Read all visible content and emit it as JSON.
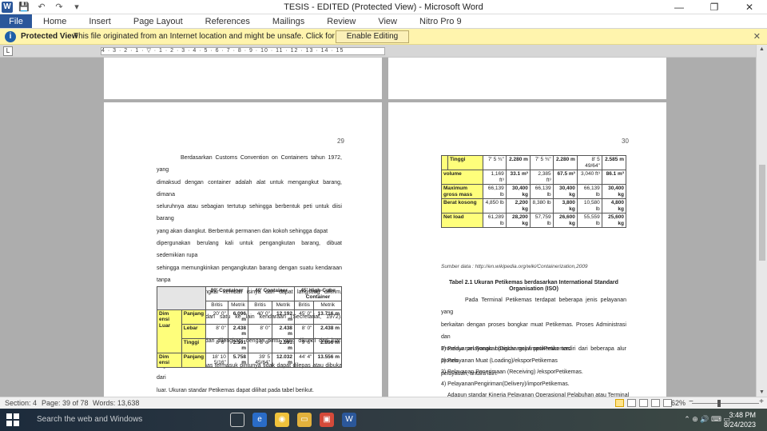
{
  "titlebar": {
    "title": "TESIS - EDITED (Protected View) - Microsoft Word",
    "app_icon": "W",
    "minimize": "—",
    "restore": "❐",
    "close": "✕"
  },
  "qat": {
    "save": "💾",
    "undo": "↶",
    "redo": "↷",
    "customize": "▾"
  },
  "ribbon": {
    "tabs": [
      "File",
      "Home",
      "Insert",
      "Page Layout",
      "References",
      "Mailings",
      "Review",
      "View",
      "Nitro Pro 9"
    ]
  },
  "protected_view": {
    "title": "Protected View",
    "message": "This file originated from an Internet location and might be unsafe. Click for more details.",
    "button": "Enable Editing",
    "close": "✕"
  },
  "ruler": {
    "marks": "4 · 3 · 2 · 1 · ▽ · 1 · 2 · 3 · 4 · 5 · 6 · 7 · 8 · 9 · 10 · 11 · 12 · 13 · 14 · 15"
  },
  "pages": {
    "left": {
      "number": "29",
      "paragraph_lines": [
        "Berdasarkan Customs Convention on Containers tahun 1972, yang",
        "dimaksud dengan container adalah alat untuk mengangkut barang, dimana",
        "seluruhnya atau sebagian tertutup sehingga berbentuk peti untuk diisi barang",
        "yang akan diangkut. Berbentuk permanen dan kokoh sehingga dapat",
        "dipergunakan berulang kali untuk pengangkutan barang, dibuat sedemikian rupa",
        "sehingga memungkinkan pengangkutan barang dengan suatu kendaraan tanpa",
        "terlebih dulu dibongkar kembali isinya dan dapat langsung dikirim, khususnya",
        "apabila dipindah dari satu ke lain kendaraan (Secretariat, 1972). Petikemas",
        "dibuat kokoh/kuat dan dilengkapi dengan pintu yang dikunci dari luar. Semua",
        "bagian dari Petikemas termasuk pintunya tidak dapat dilepas atau dibuka dari",
        "luar. Ukuran standar Petikemas dapat dilihat pada tabel berikut."
      ],
      "table": {
        "group_headers": [
          "20' Container",
          "40' Container",
          "45' High-Cube Container"
        ],
        "sub_headers": [
          "Britis",
          "Metrik",
          "Britis",
          "Metrik",
          "Britis",
          "Metrik"
        ],
        "rows": [
          {
            "group": "Dim ensi Luar",
            "label": "Panjang",
            "cells": [
              "20' 0\"",
              "6.096 m",
              "40' 0\"",
              "12.192 m",
              "45' 0\"",
              "13.716 m"
            ]
          },
          {
            "group": "",
            "label": "Lebar",
            "cells": [
              "8' 0\"",
              "2.438 m",
              "8' 0\"",
              "2.438 m",
              "8' 0\"",
              "2.438 m"
            ]
          },
          {
            "group": "",
            "label": "Tinggi",
            "cells": [
              "8' 6\"",
              "2.591 m",
              "8' 6\"",
              "2.591 m",
              "9' 6\"",
              "2.896 m"
            ]
          },
          {
            "group": "Dim ensi",
            "label": "Panjang",
            "cells": [
              "18' 10 5/16\"",
              "5.758 m",
              "39' 5 45/64\"",
              "12.032 m",
              "44' 4\"",
              "13.556 m"
            ]
          }
        ]
      }
    },
    "right": {
      "number": "30",
      "table": {
        "rows": [
          {
            "label": "Tinggi",
            "cells": [
              "7' 5 ¾\"",
              "2.280 m",
              "7' 5 ¾\"",
              "2.280 m",
              "8' 5 49/64\"",
              "2.585 m"
            ]
          },
          {
            "label": "volume",
            "cells": [
              "1,169 ft³",
              "33.1 m³",
              "2,385 ft³",
              "67.5 m³",
              "3,040 ft³",
              "86.1 m³"
            ]
          },
          {
            "label": "Maximum gross mass",
            "cells": [
              "66,139 lb",
              "30,400 kg",
              "66,139 lb",
              "30,400 kg",
              "66,139 lb",
              "30,400 kg"
            ]
          },
          {
            "label": "Berat kosong",
            "cells": [
              "4,850 lb",
              "2,200 kg",
              "8,380 lb",
              "3,800 kg",
              "10,580 lb",
              "4,800 kg"
            ]
          },
          {
            "label": "Net load",
            "cells": [
              "61,289 lb",
              "28,200 kg",
              "57,759 lb",
              "26,600 kg",
              "55,559 lb",
              "25,600 kg"
            ]
          }
        ]
      },
      "source": "Sumber data : http://en.wikipedia.org/wiki/Containerization,2009",
      "caption_line1": "Tabel 2.1 Ukuran Petikemas berdasarkan International Standard",
      "caption_line2": "Organisation (ISO)",
      "paragraph_lines": [
        "Pada Terminal Petikemas terdapat beberapa jenis pelayanan yang",
        "berkaitan dengan proses bongkar muat Petikemas. Proses Administrasi dan",
        "Prosedur pelayanan bongkar muat petikemas terdiri dari beberapa alur proses",
        "pelayanan, antara lain:"
      ],
      "list": [
        "1) Pelayanan Bongkar (Discharge) /imporPetikemas.",
        "2) Pelayanan Muat (Loading)/eksporPetikemas",
        "3) Pelayanan Penerimaan (Receiving) /eksporPetikemas.",
        "4) PelayananPengiriman(Delivery)/imporPetikemas.",
        "Adapun standar Kinerja Pelayanan Operasional Pelabuhan atau Terminal"
      ]
    }
  },
  "statusbar": {
    "section": "Section: 4",
    "page": "Page: 39 of 78",
    "words": "Words: 13,638",
    "zoom": "62%",
    "minus": "−",
    "plus": "+"
  },
  "taskbar": {
    "search_placeholder": "Search the web and Windows",
    "time": "3:48 PM",
    "date": "8/24/2023",
    "tray": "⌃  ⊕  🔊  ⌨  ▭"
  }
}
